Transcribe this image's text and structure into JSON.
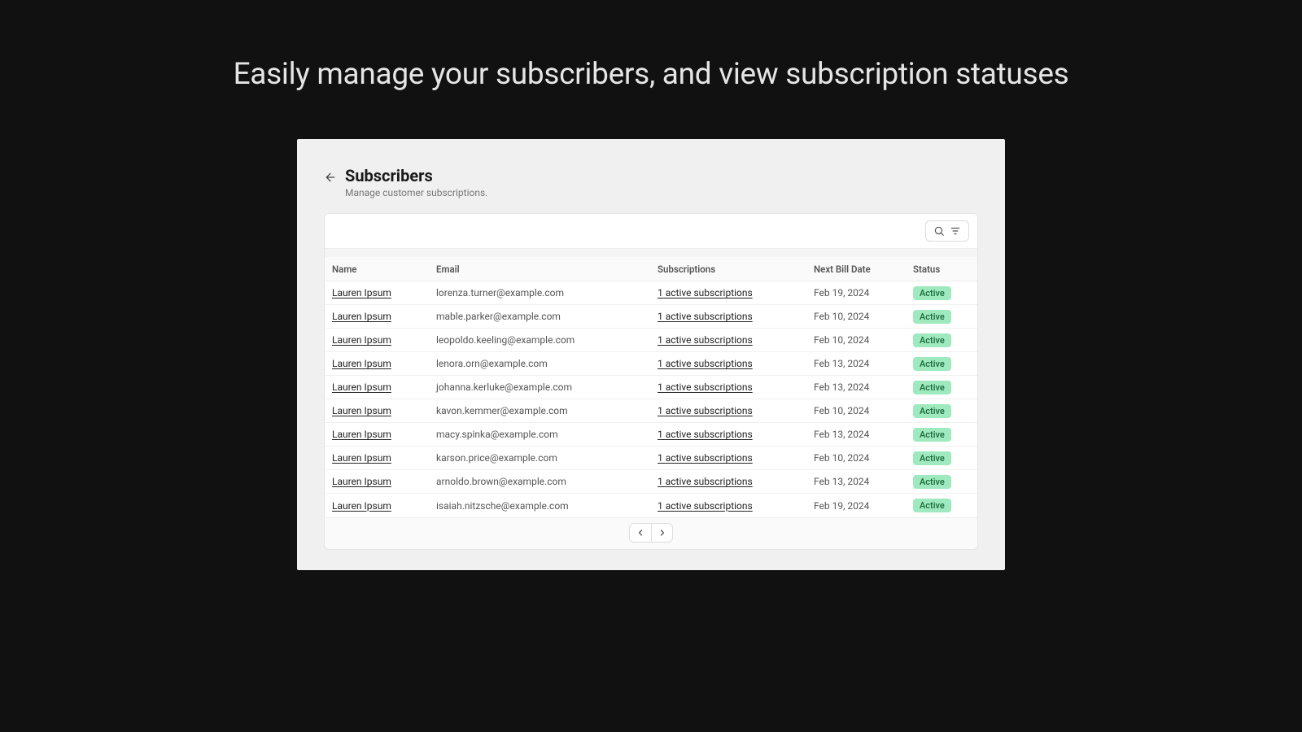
{
  "headline": "Easily manage your subscribers, and view subscription statuses",
  "page": {
    "title": "Subscribers",
    "subtitle": "Manage customer subscriptions."
  },
  "table": {
    "columns": {
      "name": "Name",
      "email": "Email",
      "subscriptions": "Subscriptions",
      "next_bill": "Next Bill Date",
      "status": "Status"
    },
    "rows": [
      {
        "name": "Lauren Ipsum",
        "email": "lorenza.turner@example.com",
        "subscriptions": "1 active subscriptions",
        "next_bill": "Feb 19, 2024",
        "status": "Active"
      },
      {
        "name": "Lauren Ipsum",
        "email": "mable.parker@example.com",
        "subscriptions": "1 active subscriptions",
        "next_bill": "Feb 10, 2024",
        "status": "Active"
      },
      {
        "name": "Lauren Ipsum",
        "email": "leopoldo.keeling@example.com",
        "subscriptions": "1 active subscriptions",
        "next_bill": "Feb 10, 2024",
        "status": "Active"
      },
      {
        "name": "Lauren Ipsum",
        "email": "lenora.orn@example.com",
        "subscriptions": "1 active subscriptions",
        "next_bill": "Feb 13, 2024",
        "status": "Active"
      },
      {
        "name": "Lauren Ipsum",
        "email": "johanna.kerluke@example.com",
        "subscriptions": "1 active subscriptions",
        "next_bill": "Feb 13, 2024",
        "status": "Active"
      },
      {
        "name": "Lauren Ipsum",
        "email": "kavon.kemmer@example.com",
        "subscriptions": "1 active subscriptions",
        "next_bill": "Feb 10, 2024",
        "status": "Active"
      },
      {
        "name": "Lauren Ipsum",
        "email": "macy.spinka@example.com",
        "subscriptions": "1 active subscriptions",
        "next_bill": "Feb 13, 2024",
        "status": "Active"
      },
      {
        "name": "Lauren Ipsum",
        "email": "karson.price@example.com",
        "subscriptions": "1 active subscriptions",
        "next_bill": "Feb 10, 2024",
        "status": "Active"
      },
      {
        "name": "Lauren Ipsum",
        "email": "arnoldo.brown@example.com",
        "subscriptions": "1 active subscriptions",
        "next_bill": "Feb 13, 2024",
        "status": "Active"
      },
      {
        "name": "Lauren Ipsum",
        "email": "isaiah.nitzsche@example.com",
        "subscriptions": "1 active subscriptions",
        "next_bill": "Feb 19, 2024",
        "status": "Active"
      }
    ]
  }
}
